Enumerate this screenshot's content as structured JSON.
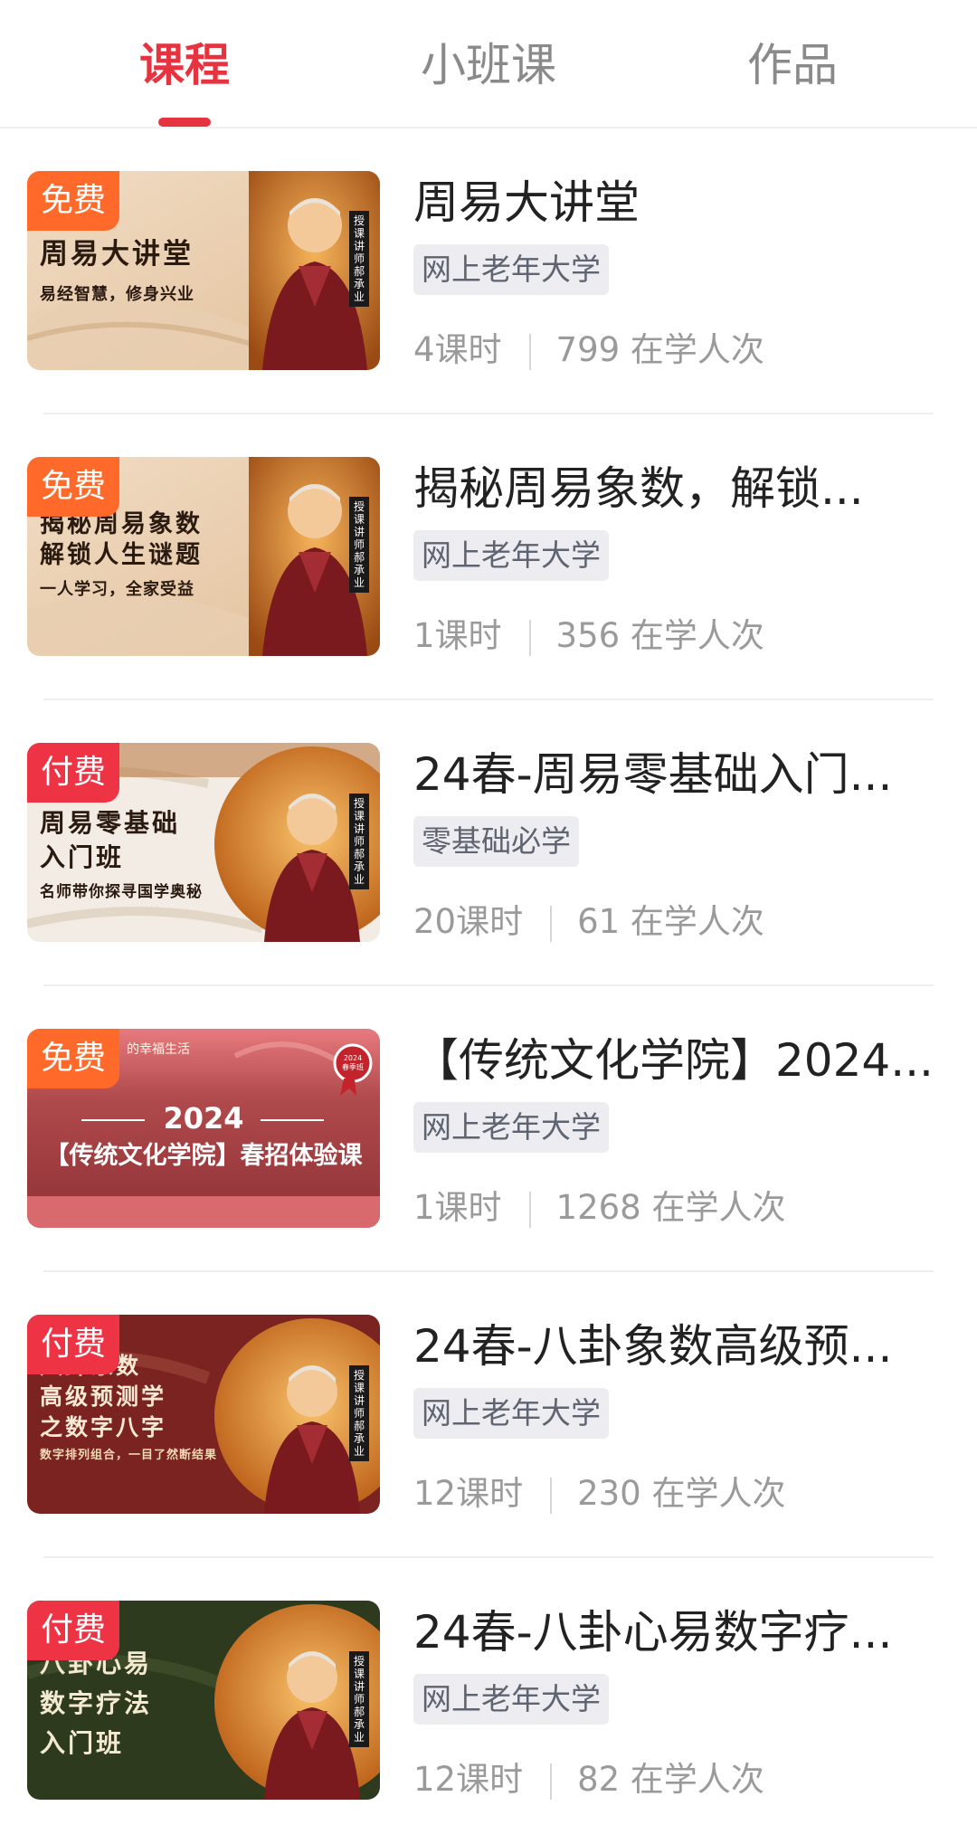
{
  "tabs": [
    {
      "label": "课程",
      "active": true
    },
    {
      "label": "小班课",
      "active": false
    },
    {
      "label": "作品",
      "active": false
    }
  ],
  "colors": {
    "accent": "#e5343f",
    "free_badge": "#ff6a2a",
    "paid_badge": "#ee3345"
  },
  "courses": [
    {
      "badge": "免费",
      "badge_type": "free",
      "title": "周易大讲堂",
      "tag": "网上老年大学",
      "lessons": "4课时",
      "learners": "799 在学人次",
      "thumb_title": "周易大讲堂",
      "thumb_subtitle": "易经智慧，修身兴业",
      "thumb_teacher": "授课讲师 郝承业"
    },
    {
      "badge": "免费",
      "badge_type": "free",
      "title": "揭秘周易象数，解锁...",
      "tag": "网上老年大学",
      "lessons": "1课时",
      "learners": "356 在学人次",
      "thumb_title": "揭秘周易象数\n解锁人生谜题",
      "thumb_subtitle": "一人学习，全家受益",
      "thumb_teacher": "授课讲师 郝承业"
    },
    {
      "badge": "付费",
      "badge_type": "paid",
      "title": "24春-周易零基础入门...",
      "tag": "零基础必学",
      "lessons": "20课时",
      "learners": "61 在学人次",
      "thumb_title": "周易零基础\n入门班",
      "thumb_subtitle": "名师带你探寻国学奥秘",
      "thumb_teacher": "授课讲师 郝承业"
    },
    {
      "badge": "免费",
      "badge_type": "free",
      "title": "【传统文化学院】2024...",
      "tag": "网上老年大学",
      "lessons": "1课时",
      "learners": "1268 在学人次",
      "thumb_year": "2024",
      "thumb_title": "【传统文化学院】春招体验课",
      "thumb_top": "的幸福生活",
      "thumb_seal": "2024 春季班"
    },
    {
      "badge": "付费",
      "badge_type": "paid",
      "title": "24春-八卦象数高级预...",
      "tag": "网上老年大学",
      "lessons": "12课时",
      "learners": "230 在学人次",
      "thumb_title": "八卦象数\n高级预测学\n之数字八字",
      "thumb_subtitle": "数字排列组合，一目了然断结果",
      "thumb_teacher": "授课讲师 郝承业"
    },
    {
      "badge": "付费",
      "badge_type": "paid",
      "title": "24春-八卦心易数字疗...",
      "tag": "网上老年大学",
      "lessons": "12课时",
      "learners": "82 在学人次",
      "thumb_title": "八卦心易\n数字疗法\n入门班",
      "thumb_subtitle": "",
      "thumb_teacher": "授课讲师 郝承业"
    }
  ]
}
